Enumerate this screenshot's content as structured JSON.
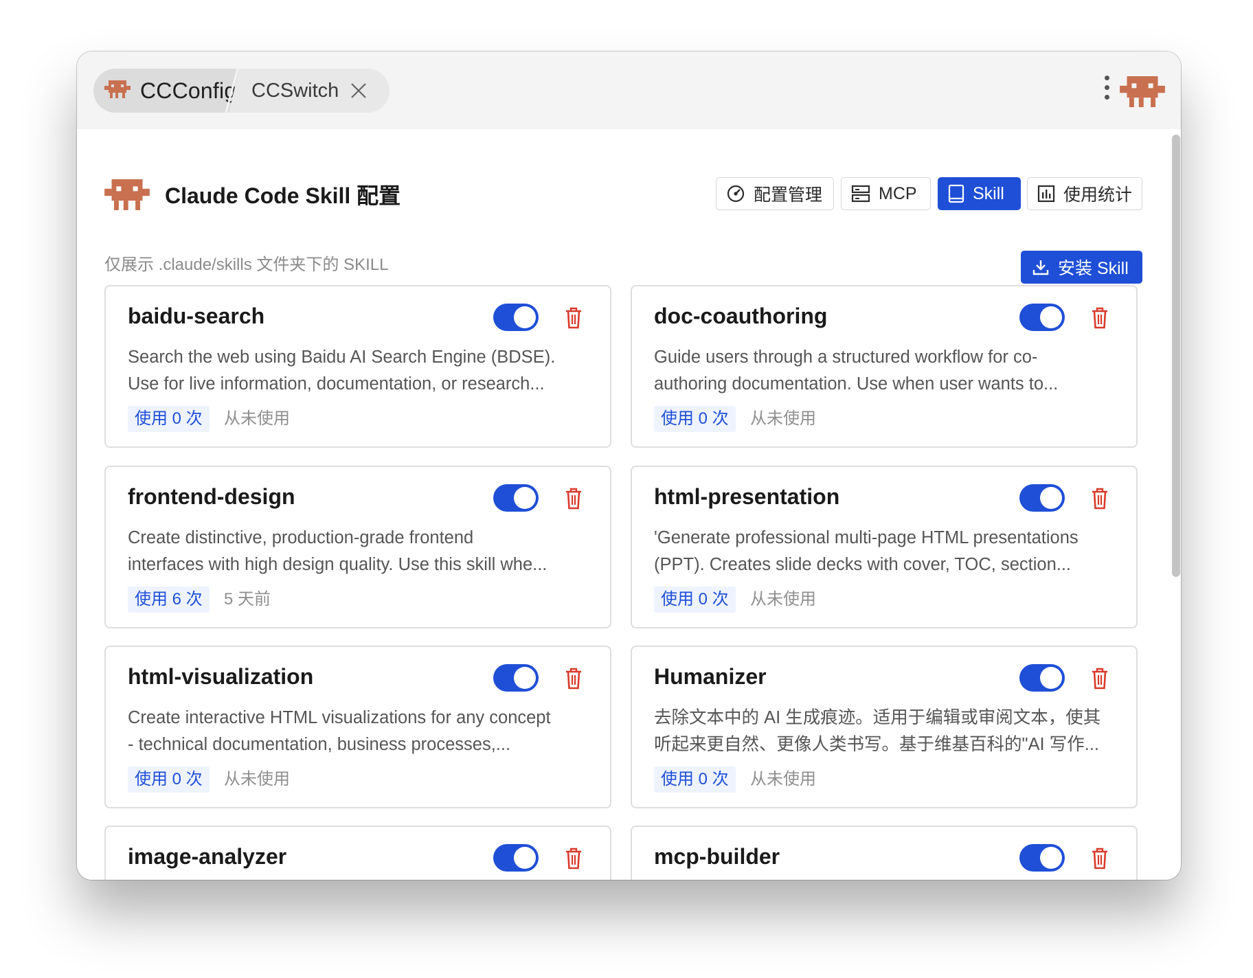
{
  "window": {
    "tabs": [
      {
        "label": "CCConfig",
        "active": true
      },
      {
        "label": "CCSwitch",
        "active": false
      }
    ]
  },
  "header": {
    "title": "Claude Code Skill 配置",
    "nav": [
      {
        "label": "配置管理",
        "icon": "gauge-icon",
        "active": false
      },
      {
        "label": "MCP",
        "icon": "server-icon",
        "active": false
      },
      {
        "label": "Skill",
        "icon": "book-icon",
        "active": true
      },
      {
        "label": "使用统计",
        "icon": "bar-chart-icon",
        "active": false
      }
    ]
  },
  "subtitle": "仅展示 .claude/skills 文件夹下的 SKILL",
  "install_button": "安装 Skill",
  "skills": [
    {
      "name": "baidu-search",
      "enabled": true,
      "desc_lines": [
        "Search the web using Baidu AI Search Engine (BDSE).",
        "Use for live information, documentation, or research..."
      ],
      "usage": "使用 0 次",
      "last_used": "从未使用"
    },
    {
      "name": "doc-coauthoring",
      "enabled": true,
      "desc_lines": [
        "Guide users through a structured workflow for co-",
        "authoring documentation. Use when user wants to..."
      ],
      "usage": "使用 0 次",
      "last_used": "从未使用"
    },
    {
      "name": "frontend-design",
      "enabled": true,
      "desc_lines": [
        "Create distinctive, production-grade frontend",
        "interfaces with high design quality. Use this skill whe..."
      ],
      "usage": "使用 6 次",
      "last_used": "5 天前"
    },
    {
      "name": "html-presentation",
      "enabled": true,
      "desc_lines": [
        "'Generate professional multi-page HTML presentations",
        "(PPT). Creates slide decks with cover, TOC, section..."
      ],
      "usage": "使用 0 次",
      "last_used": "从未使用"
    },
    {
      "name": "html-visualization",
      "enabled": true,
      "desc_lines": [
        "Create interactive HTML visualizations for any concept",
        "- technical documentation, business processes,..."
      ],
      "usage": "使用 0 次",
      "last_used": "从未使用"
    },
    {
      "name": "Humanizer",
      "enabled": true,
      "desc_lines": [
        "去除文本中的 AI 生成痕迹。适用于编辑或审阅文本，使其",
        "听起来更自然、更像人类书写。基于维基百科的\"AI 写作..."
      ],
      "usage": "使用 0 次",
      "last_used": "从未使用"
    },
    {
      "name": "image-analyzer",
      "enabled": true,
      "desc_lines": [],
      "usage": "",
      "last_used": ""
    },
    {
      "name": "mcp-builder",
      "enabled": true,
      "desc_lines": [],
      "usage": "",
      "last_used": ""
    }
  ],
  "colors": {
    "accent": "#1f4fd6",
    "danger": "#d93a2b",
    "mascot": "#c8704f"
  }
}
